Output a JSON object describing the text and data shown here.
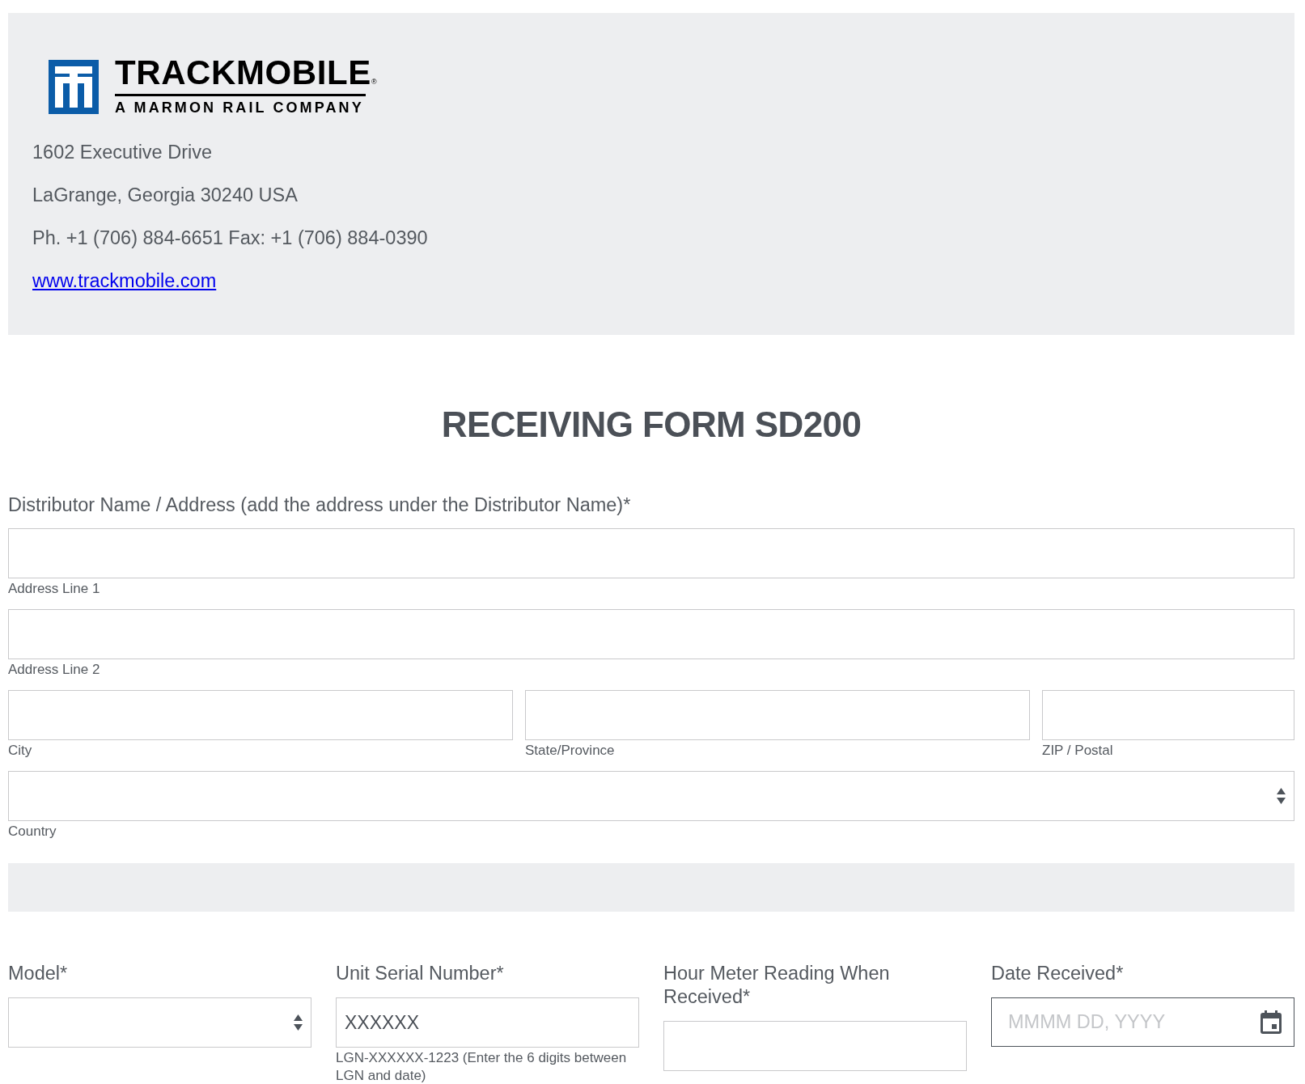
{
  "header": {
    "logo": {
      "wordmark": "TRACKMOBILE$_{®}$",
      "tagline": "A MARMON RAIL COMPANY"
    },
    "address_lines": [
      "1602 Executive Drive",
      "LaGrange, Georgia 30240 USA",
      "Ph. +1 (706) 884-6651 Fax: +1 (706) 884-0390"
    ],
    "website_link": "www.trackmobile.com"
  },
  "form": {
    "title": "RECEIVING FORM SD200",
    "distributor": {
      "label": "Distributor Name / Address (add the address under the Distributor Name)*",
      "rows": [
        {
          "fields": [
            {
              "kind": "text",
              "caption": "Address Line 1"
            }
          ]
        },
        {
          "fields": [
            {
              "kind": "text",
              "caption": "Address Line 2"
            }
          ]
        },
        {
          "fields": [
            {
              "kind": "text",
              "caption": "City"
            },
            {
              "kind": "text",
              "caption": "State/Province"
            },
            {
              "kind": "text",
              "caption": "ZIP / Postal"
            }
          ]
        },
        {
          "fields": [
            {
              "kind": "select",
              "caption": "Country"
            }
          ]
        }
      ]
    },
    "unit_fields": [
      {
        "kind": "select",
        "label": "Model*"
      },
      {
        "kind": "text",
        "label": "Unit Serial Number*",
        "value": "XXXXXX",
        "hint": "LGN-XXXXXX-1223 (Enter the 6 digits between LGN and date)"
      },
      {
        "kind": "text",
        "label": "Hour Meter Reading When Received*"
      },
      {
        "kind": "date",
        "label": "Date Received*",
        "placeholder": "MMMM DD, YYYY"
      }
    ]
  }
}
